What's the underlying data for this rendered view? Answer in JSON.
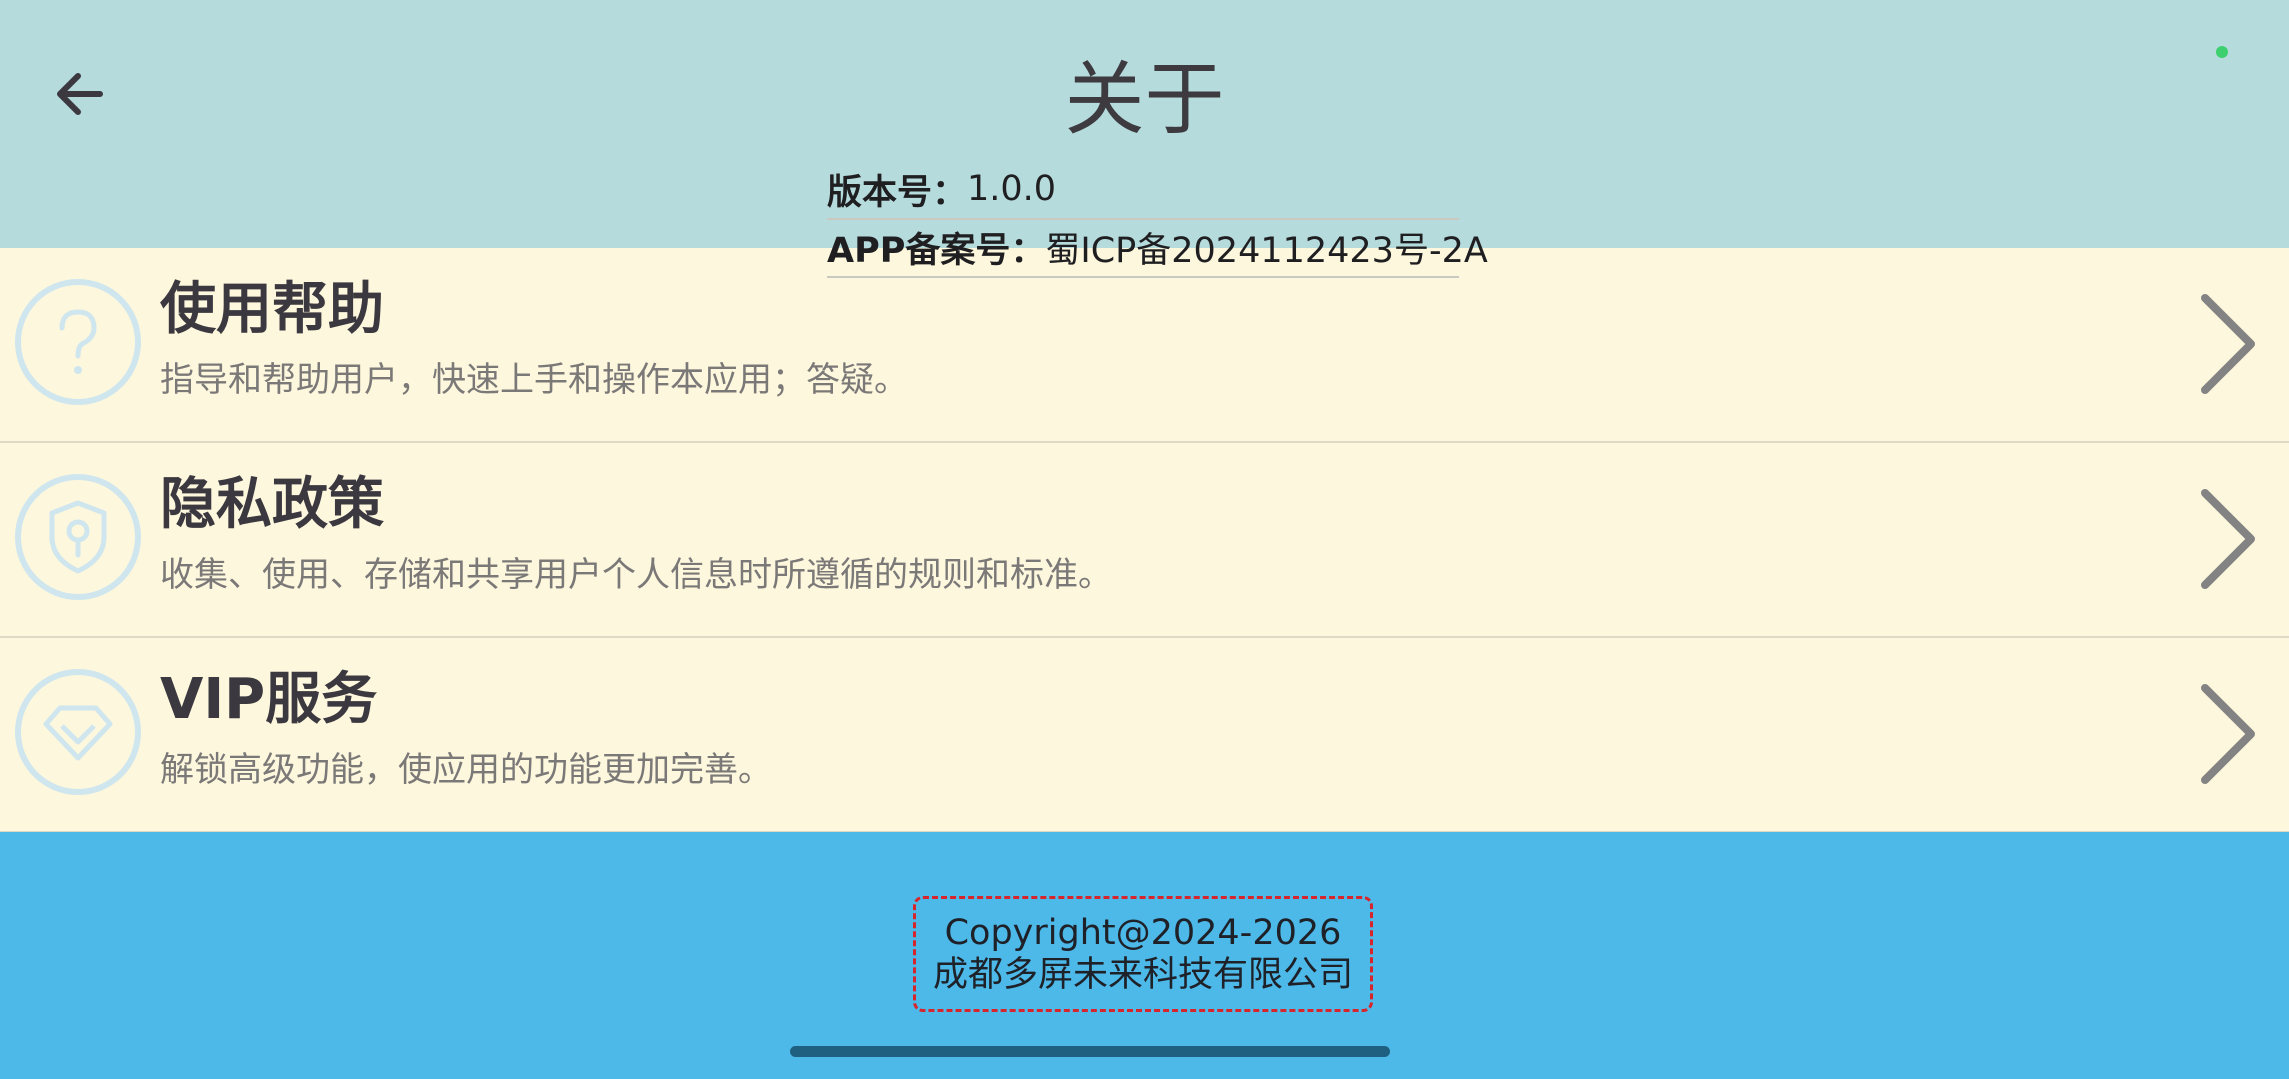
{
  "header": {
    "title": "关于",
    "version_label": "版本号：",
    "version_value": "1.0.0",
    "record_label": "APP备案号：",
    "record_value": "蜀ICP备2024112423号-2A"
  },
  "items": [
    {
      "icon": "help-circle-icon",
      "title": "使用帮助",
      "desc": "指导和帮助用户，快速上手和操作本应用；答疑。"
    },
    {
      "icon": "shield-lock-icon",
      "title": "隐私政策",
      "desc": "收集、使用、存储和共享用户个人信息时所遵循的规则和标准。"
    },
    {
      "icon": "diamond-icon",
      "title": "VIP服务",
      "desc": "解锁高级功能，使应用的功能更加完善。"
    }
  ],
  "footer": {
    "copyright_line1": "Copyright@2024-2026",
    "copyright_line2": "成都多屏未来科技有限公司"
  },
  "colors": {
    "header_bg": "#b5dbdc",
    "list_bg": "#fdf7dd",
    "footer_bg": "#4db9e9",
    "copyright_border": "#d8242b",
    "status_dot": "#3ecf6e"
  }
}
